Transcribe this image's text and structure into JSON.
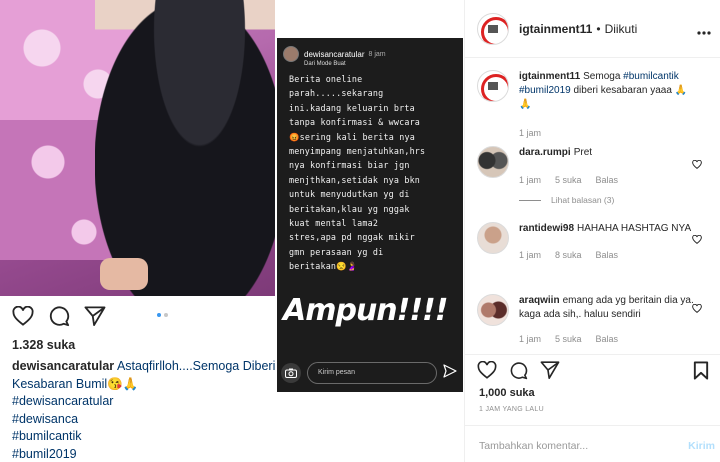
{
  "left_post": {
    "story": {
      "username": "dewisancaratular",
      "time": "8 jam",
      "subtitle": "Dari Mode Buat",
      "body": "Berita oneline\nparah.....sekarang\nini.kadang keluarin brta\ntanpa konfirmasi & wwcara\n😡sering kali berita nya\nmenyimpang menjatuhkan,hrs\nnya konfirmasi biar jgn\nmenjthkan,setidak nya bkn\nuntuk menyudutkan yg di\nberitakan,klau yg nggak\nkuat mental lama2\nstres,apa pd nggak mikir\ngmn perasaan yg di\nberitakan😒🤰",
      "shout": "Ampun!!!!",
      "reply_placeholder": "Kirim pesan"
    },
    "likes": "1.328 suka",
    "caption_user": "dewisancaratular",
    "caption_text": "Astaqfirlloh....Semoga Diberi Kesabaran Bumil😘🙏",
    "hashtags": [
      "#dewisancaratular",
      "#dewisanca",
      "#bumilcantik",
      "#bumil2019"
    ]
  },
  "header": {
    "username": "igtainment11",
    "separator": "•",
    "follow_status": "Diikuti"
  },
  "caption": {
    "username": "igtainment11",
    "text_prefix": "Semoga ",
    "tag1": "#bumilcantik",
    "tag2": "#bumil2019",
    "text_suffix": " diberi kesabaran yaaa 🙏🙏",
    "time": "1 jam"
  },
  "comments": [
    {
      "username": "dara.rumpi",
      "text": "Pret",
      "time": "1 jam",
      "likes": "5 suka",
      "reply": "Balas",
      "view_replies": "Lihat balasan (3)"
    },
    {
      "username": "rantidewi98",
      "text": "HAHAHA HASHTAG NYA",
      "time": "1 jam",
      "likes": "8 suka",
      "reply": "Balas"
    },
    {
      "username": "araqwiin",
      "text": "emang ada yg beritain dia ya. kaga ada sih,. haluu sendiri",
      "time": "1 jam",
      "likes": "5 suka",
      "reply": "Balas"
    }
  ],
  "actions": {
    "likes": "1,000 suka",
    "timestamp": "1 JAM YANG LALU",
    "comment_placeholder": "Tambahkan komentar...",
    "post_label": "Kirim"
  },
  "icons": [
    "heart-icon",
    "comment-icon",
    "share-icon",
    "bookmark-icon",
    "more-icon",
    "camera-icon",
    "send-icon"
  ],
  "colors": {
    "link": "#003569",
    "muted": "#8e8e8e",
    "post_disabled": "#b2dffc",
    "carousel_dot_active": "#3897f0"
  }
}
